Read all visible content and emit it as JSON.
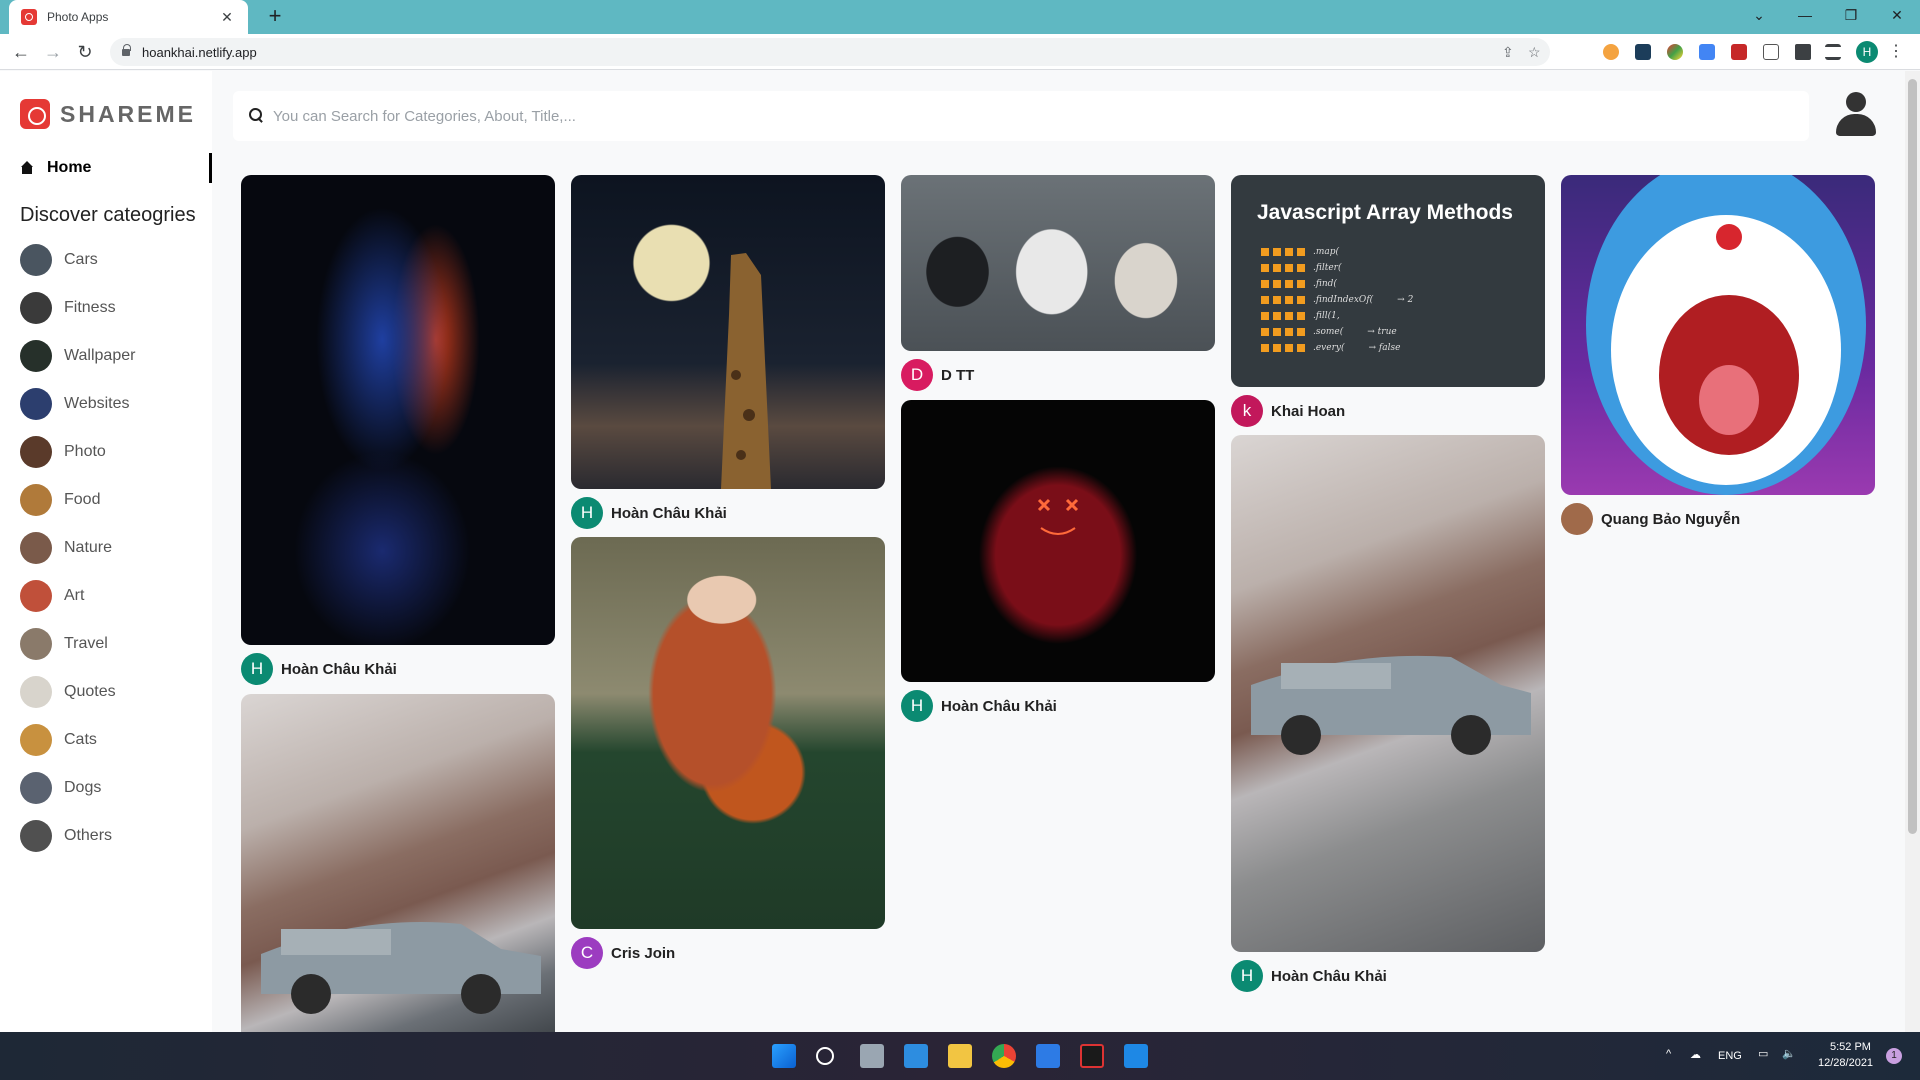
{
  "browser": {
    "tab_title": "Photo Apps",
    "tab_close": "✕",
    "new_tab": "+",
    "url": "hoankhai.netlify.app",
    "profile_initial": "H",
    "window_controls": [
      "⌄",
      "—",
      "❐",
      "✕"
    ]
  },
  "app": {
    "logo_text": "SHAREME",
    "home_label": "Home",
    "discover_label": "Discover cateogries",
    "search_placeholder": "You can Search for Categories, About, Title,...",
    "categories": [
      {
        "label": "Cars",
        "color": "#4a5560"
      },
      {
        "label": "Fitness",
        "color": "#3a3a3a"
      },
      {
        "label": "Wallpaper",
        "color": "#26302a"
      },
      {
        "label": "Websites",
        "color": "#2c3e6e"
      },
      {
        "label": "Photo",
        "color": "#5a3a2a"
      },
      {
        "label": "Food",
        "color": "#b07a3a"
      },
      {
        "label": "Nature",
        "color": "#7a5a4a"
      },
      {
        "label": "Art",
        "color": "#c0503a"
      },
      {
        "label": "Travel",
        "color": "#8a7a6a"
      },
      {
        "label": "Quotes",
        "color": "#d8d4cc"
      },
      {
        "label": "Cats",
        "color": "#c8913f"
      },
      {
        "label": "Dogs",
        "color": "#5a6270"
      },
      {
        "label": "Others",
        "color": "#505050"
      }
    ]
  },
  "pins": [
    {
      "author": "Hoàn Châu Khải",
      "initial": "H",
      "avatar_color": "#0b8a72",
      "image": "woman-neon-portrait"
    },
    {
      "author": "",
      "initial": "",
      "avatar_color": "",
      "image": "vintage-car-tent"
    },
    {
      "author": "Hoàn Châu Khải",
      "initial": "H",
      "avatar_color": "#0b8a72",
      "image": "giraffe-moon"
    },
    {
      "author": "Cris Join",
      "initial": "C",
      "avatar_color": "#9c3cc0",
      "image": "girl-with-fox"
    },
    {
      "author": "D TT",
      "initial": "D",
      "avatar_color": "#d81b60",
      "image": "racing-team-celebration"
    },
    {
      "author": "Hoàn Châu Khải",
      "initial": "H",
      "avatar_color": "#0b8a72",
      "image": "neon-mask-hoodie"
    },
    {
      "author": "Khai Hoan",
      "initial": "k",
      "avatar_color": "#c2185b",
      "image": "javascript-array-methods"
    },
    {
      "author": "Hoàn Châu Khải",
      "initial": "H",
      "avatar_color": "#0b8a72",
      "image": "vintage-car-tent"
    },
    {
      "author": "Quang Bảo Nguyễn",
      "initial": "",
      "avatar_color": "#a06a4a",
      "image": "doraemon-scream"
    }
  ],
  "code_card": {
    "title": "Javascript Array Methods",
    "methods": [
      ".map(",
      ".filter(",
      ".find(",
      ".findIndexOf(",
      ".fill(1,",
      ".some(",
      ".every("
    ],
    "results": [
      "",
      "",
      "",
      "→ 2",
      "",
      "→ true",
      "→ false"
    ]
  },
  "taskbar": {
    "lang": "ENG",
    "time": "5:52 PM",
    "date": "12/28/2021",
    "notification_count": "1"
  }
}
